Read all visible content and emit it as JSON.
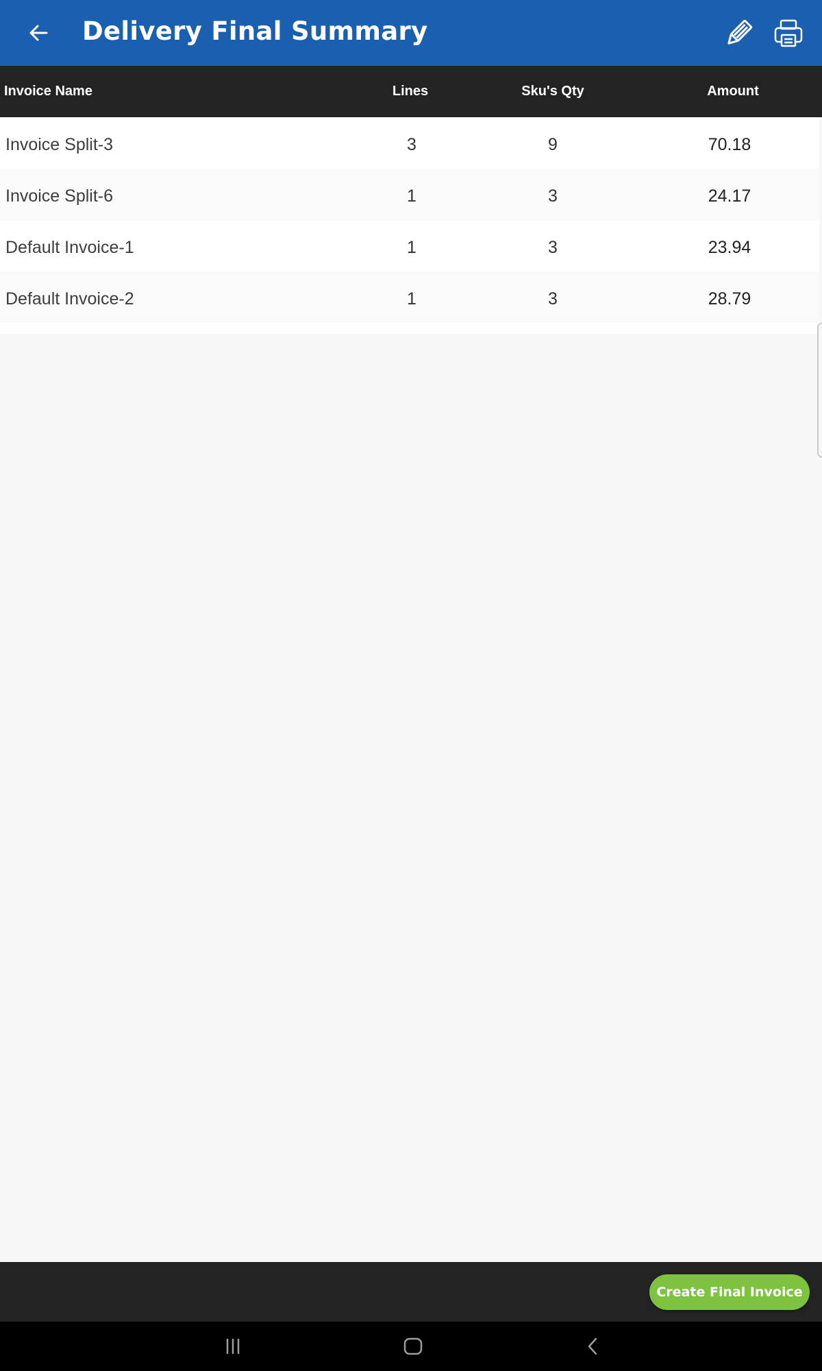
{
  "app_bar": {
    "title": "Delivery Final Summary",
    "background_color": "#1a5fb0",
    "icons": [
      "back-arrow-icon",
      "pencil-icon",
      "printer-icon"
    ]
  },
  "table": {
    "headers": {
      "name": "Invoice Name",
      "lines": "Lines",
      "qty": "Sku's Qty",
      "amount": "Amount"
    },
    "rows": [
      {
        "name": "Invoice Split-3",
        "lines": "3",
        "qty": "9",
        "amount": "70.18"
      },
      {
        "name": "Invoice Split-6",
        "lines": "1",
        "qty": "3",
        "amount": "24.17"
      },
      {
        "name": "Default Invoice-1",
        "lines": "1",
        "qty": "3",
        "amount": "23.94"
      },
      {
        "name": "Default Invoice-2",
        "lines": "1",
        "qty": "3",
        "amount": "28.79"
      }
    ]
  },
  "footer": {
    "create_button_label": "Create Final Invoice",
    "button_color": "#7ec242"
  },
  "system_nav": {
    "icons": [
      "recent-apps-icon",
      "home-icon",
      "back-icon"
    ]
  }
}
